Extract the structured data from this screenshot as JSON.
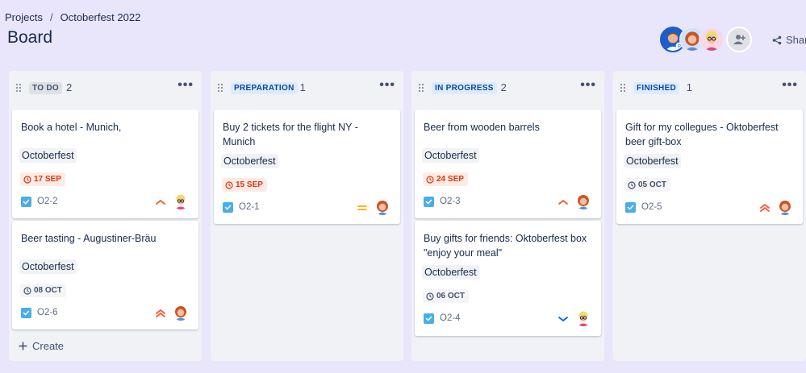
{
  "breadcrumb": {
    "projects": "Projects",
    "separator": "/",
    "project": "Octoberfest 2022"
  },
  "page_title": "Board",
  "share_label": "Share",
  "create_label": "Create",
  "colors": {
    "overdue": "#de350b",
    "story": "#4bade8",
    "priority_high": "#ff5630",
    "priority_medium": "#ffab00",
    "priority_low": "#0065ff"
  },
  "columns": [
    {
      "title": "TO DO",
      "count": "2",
      "title_bg": "#dfe1e6",
      "title_color": "#42526e",
      "cards": [
        {
          "title": "Book a hotel - Munich,",
          "epic": "Octoberfest",
          "due": "17 SEP",
          "due_state": "overdue",
          "key": "O2-2",
          "priority": "high",
          "assignee": "woman-glasses-avatar"
        },
        {
          "title": "Beer tasting - Augustiner-Bräu",
          "epic": "Octoberfest",
          "due": "08 OCT",
          "due_state": "normal",
          "key": "O2-6",
          "priority": "highest",
          "assignee": "woman-red-hair-avatar"
        }
      ]
    },
    {
      "title": "PREPARATION",
      "count": "1",
      "title_bg": "#deebff",
      "title_color": "#0747a6",
      "cards": [
        {
          "title": "Buy 2 tickets for the flight NY - Munich",
          "epic": "Octoberfest",
          "due": "15 SEP",
          "due_state": "overdue",
          "key": "O2-1",
          "priority": "medium",
          "assignee": "woman-red-hair-avatar"
        }
      ]
    },
    {
      "title": "IN PROGRESS",
      "count": "2",
      "title_bg": "#deebff",
      "title_color": "#0747a6",
      "cards": [
        {
          "title": "Beer from wooden barrels",
          "epic": "Octoberfest",
          "due": "24 SEP",
          "due_state": "overdue",
          "key": "O2-3",
          "priority": "high",
          "assignee": "woman-red-hair-avatar"
        },
        {
          "title": "Buy gifts for friends: Oktoberfest box \"enjoy your meal\"",
          "epic": "Octoberfest",
          "due": "06 OCT",
          "due_state": "normal",
          "key": "O2-4",
          "priority": "low",
          "assignee": "woman-glasses-avatar"
        }
      ]
    },
    {
      "title": "FINISHED",
      "count": "1",
      "title_bg": "#deebff",
      "title_color": "#0747a6",
      "cards": [
        {
          "title": "Gift for my collegues - Oktoberfest beer gift-box",
          "epic": "Octoberfest",
          "due": "05 OCT",
          "due_state": "normal",
          "key": "O2-5",
          "priority": "highest",
          "assignee": "woman-red-hair-avatar"
        }
      ]
    }
  ],
  "avatars": [
    {
      "icon": "man-avatar",
      "badge": "P"
    },
    {
      "icon": "woman-red-hair-avatar"
    },
    {
      "icon": "woman-glasses-avatar"
    }
  ]
}
